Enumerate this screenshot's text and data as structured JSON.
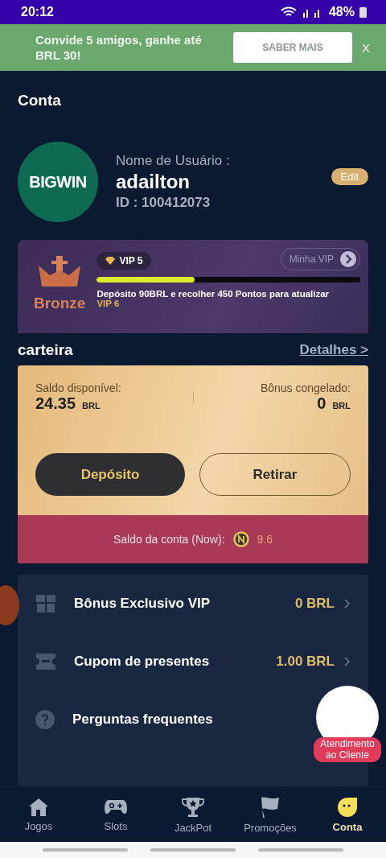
{
  "status_bar": {
    "time": "20:12",
    "battery": "48%"
  },
  "banner": {
    "text": "Convide 5 amigos, ganhe até BRL 30!",
    "button": "SABER MAIS",
    "close": "X"
  },
  "page_title": "Conta",
  "profile": {
    "logo": "BIGWIN",
    "username_label": "Nome de Usuário :",
    "username": "adailton",
    "id": "ID : 100412073",
    "edit": "Edit"
  },
  "vip": {
    "tier": "Bronze",
    "badge": "VIP 5",
    "link": "Minha VIP",
    "level": 0.37,
    "message": "Depósito 90BRL e recolher 450 Pontos para atualizar",
    "next": "VIP 6"
  },
  "wallet": {
    "title": "carteira",
    "details": "Detalhes >",
    "available_label": "Saldo disponível:",
    "available": "24.35",
    "available_currency": "BRL",
    "frozen_label": "Bônus congelado:",
    "frozen": "0",
    "frozen_currency": "BRL",
    "deposit": "Depósito",
    "withdraw": "Retirar",
    "account_label": "Saldo da conta (Now):",
    "account_value": "9.6"
  },
  "menu": [
    {
      "kind": "gift",
      "label": "Bônus Exclusivo VIP",
      "value": "0 BRL"
    },
    {
      "kind": "ticket",
      "label": "Cupom de presentes",
      "value": "1.00 BRL"
    },
    {
      "kind": "help",
      "label": "Perguntas frequentes"
    }
  ],
  "support": {
    "label": "Atendimento ao Cliente"
  },
  "nav": [
    {
      "kind": "home",
      "label": "Jogos",
      "selected": false
    },
    {
      "kind": "gamepad",
      "label": "Slots",
      "selected": false
    },
    {
      "kind": "trophy",
      "label": "JackPot",
      "selected": false
    },
    {
      "kind": "flag",
      "label": "Promoções",
      "selected": false
    },
    {
      "kind": "face",
      "label": "Conta",
      "selected": true
    }
  ]
}
